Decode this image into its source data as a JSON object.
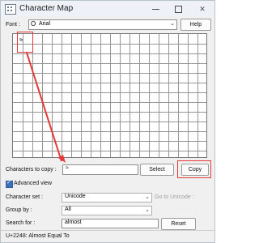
{
  "window": {
    "title": "Character Map"
  },
  "font": {
    "label": "Font :",
    "value": "Arial"
  },
  "buttons": {
    "help": "Help",
    "select": "Select",
    "copy": "Copy",
    "reset": "Reset"
  },
  "grid": {
    "first_character": "≈"
  },
  "copy": {
    "label": "Characters to copy :",
    "value": "≈"
  },
  "advanced_view": {
    "label": "Advanced view",
    "checked": true
  },
  "character_set": {
    "label": "Character set :",
    "value": "Unicode",
    "goto_label": "Go to Unicode :"
  },
  "group_by": {
    "label": "Group by :",
    "value": "All"
  },
  "search": {
    "label": "Search for :",
    "value": "almost"
  },
  "status": {
    "text": "U+2248: Almost Equal To"
  },
  "accent_color": "#e53935"
}
